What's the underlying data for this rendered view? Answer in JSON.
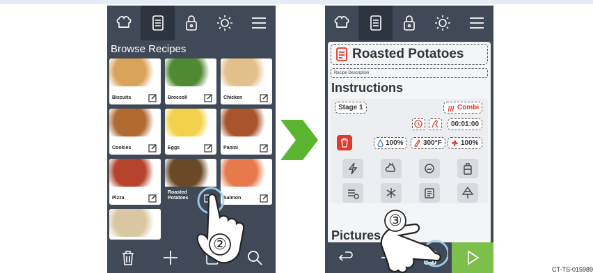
{
  "left_screen": {
    "nav": [
      "chef-hat-icon",
      "recipe-book-icon",
      "lock-icon",
      "brightness-icon",
      "menu-icon"
    ],
    "browse_title": "Browse Recipes",
    "recipes": [
      {
        "name": "Biscuits",
        "color": "#d9a45a"
      },
      {
        "name": "Broccoli",
        "color": "#4f8a32"
      },
      {
        "name": "Chicken",
        "color": "#e2c08a"
      },
      {
        "name": "Cookies",
        "color": "#b06a32"
      },
      {
        "name": "Eggs",
        "color": "#f2d24a"
      },
      {
        "name": "Panini",
        "color": "#a8542c"
      },
      {
        "name": "Pizza",
        "color": "#b6432c"
      },
      {
        "name": "Roasted Potatoes",
        "color": "#6a4a26"
      },
      {
        "name": "Salmon",
        "color": "#e77a4c"
      },
      {
        "name": "",
        "color": "#d8c7a0"
      }
    ],
    "bottom_actions": [
      "trash-icon",
      "plus-icon",
      "document-icon",
      "search-icon"
    ],
    "step_badge": "②"
  },
  "right_screen": {
    "recipe_title": "Roasted Potatoes",
    "description_placeholder": "Recipe Description",
    "instructions_heading": "Instructions",
    "stage_label": "Stage 1",
    "mode_label": "Combi",
    "time_value": "00:01:00",
    "humidity": "100%",
    "temperature": "300°F",
    "fan": "100%",
    "pictures_heading": "Pictures",
    "step_badge": "③"
  },
  "doc_id": "CT-TS-015989",
  "colors": {
    "panel": "#3f4957",
    "panel_dark": "#2c3440",
    "accent_green": "#7cc04b",
    "arrow_green": "#5cb531",
    "danger": "#e03a2c"
  }
}
